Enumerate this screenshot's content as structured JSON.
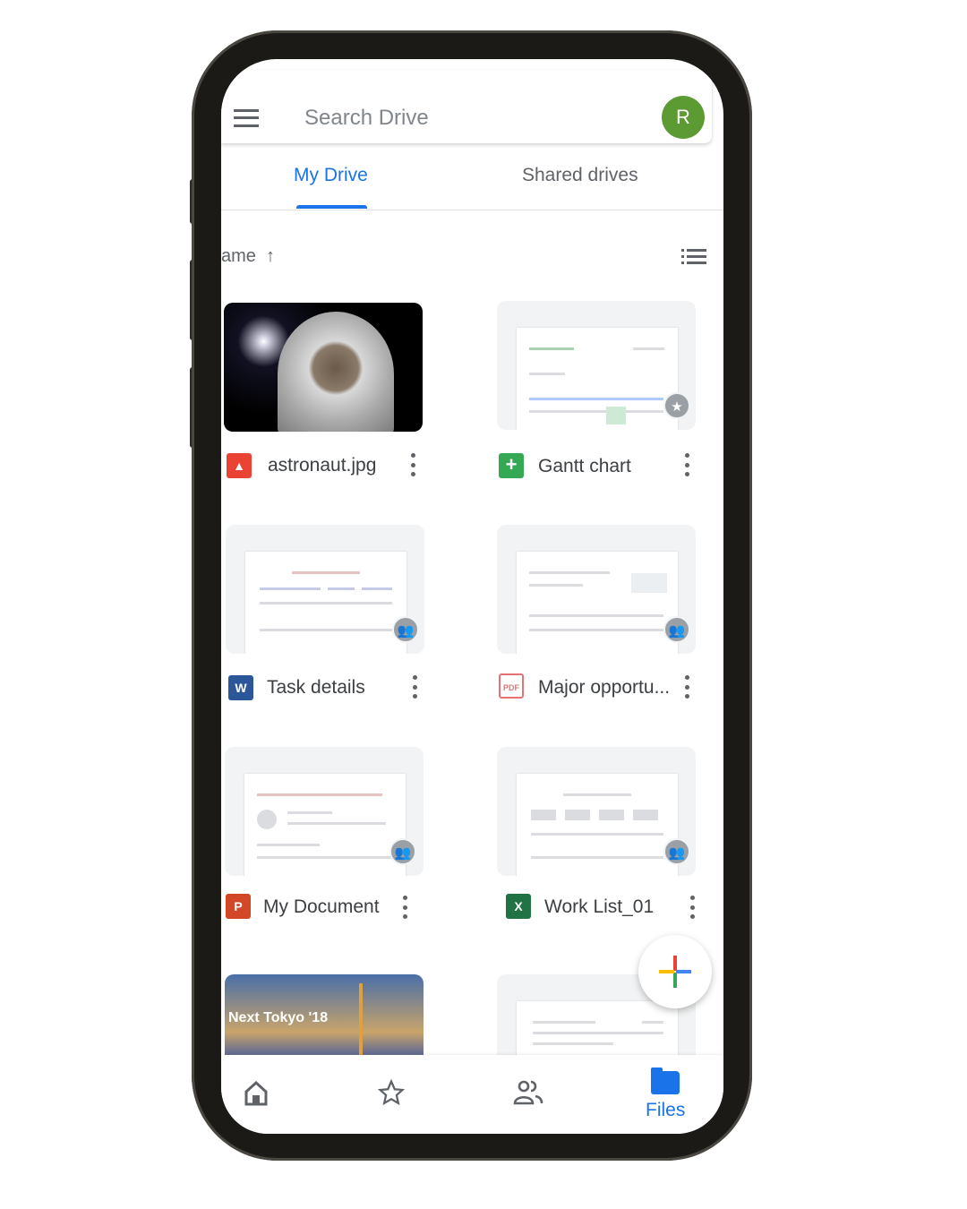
{
  "search": {
    "placeholder": "Search Drive",
    "avatar_letter": "R"
  },
  "tabs": [
    {
      "label": "My Drive",
      "active": true
    },
    {
      "label": "Shared drives",
      "active": false
    }
  ],
  "sort": {
    "label": "ame",
    "direction": "ascending",
    "arrow": "↑"
  },
  "files": [
    {
      "name": "astronaut.jpg",
      "type": "image",
      "icon": "image-icon",
      "badge": null
    },
    {
      "name": "Gantt chart",
      "type": "sheets",
      "icon": "google-sheets-icon",
      "badge": "starred"
    },
    {
      "name": "Task details",
      "type": "word",
      "icon": "word-icon",
      "icon_letter": "W",
      "badge": "shared"
    },
    {
      "name": "Major opportu...",
      "type": "pdf",
      "icon": "pdf-icon",
      "badge": "shared"
    },
    {
      "name": "My Document",
      "type": "powerpoint",
      "icon": "powerpoint-icon",
      "icon_letter": "P",
      "badge": "shared"
    },
    {
      "name": "Work List_01",
      "type": "excel",
      "icon": "excel-icon",
      "icon_letter": "X",
      "badge": "shared"
    },
    {
      "name": "",
      "type": "image",
      "thumb_text": "Next Tokyo '18"
    },
    {
      "name": "",
      "type": "doc"
    }
  ],
  "bottom_nav": [
    {
      "icon": "home-icon"
    },
    {
      "icon": "star-icon"
    },
    {
      "icon": "shared-people-icon"
    },
    {
      "icon": "folder-icon",
      "label": "Files",
      "active": true
    }
  ],
  "colors": {
    "accent": "#1a73e8",
    "avatar": "#5c9b34",
    "text": "#3c4043"
  }
}
